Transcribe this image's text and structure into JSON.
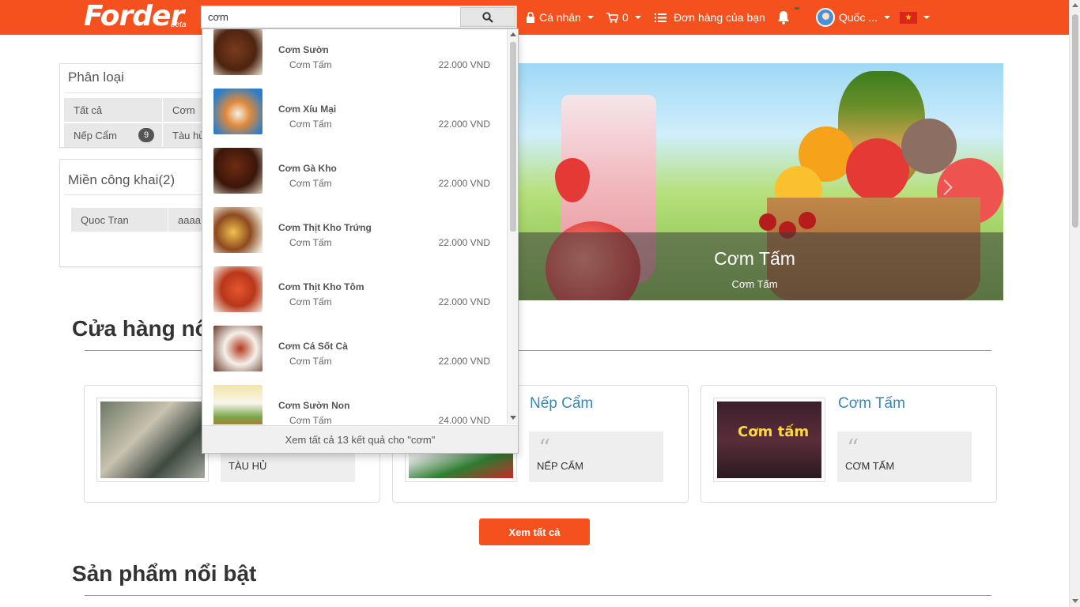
{
  "header": {
    "logo_text": "Forder",
    "logo_badge": "beta",
    "search": {
      "value": "cơm",
      "placeholder": ""
    },
    "nav": {
      "personal_label": "Cá nhân",
      "cart_count": "0",
      "orders_label": "Đơn hàng của bạn",
      "user_label": "Quốc ...",
      "flag_star": "★"
    }
  },
  "colors": {
    "brand": "#f4511e",
    "link": "#3a87b5"
  },
  "search_dropdown": {
    "items": [
      {
        "name": "Cơm Sườn",
        "category": "Cơm Tấm",
        "price": "22.000 VND"
      },
      {
        "name": "Cơm Xíu Mại",
        "category": "Cơm Tấm",
        "price": "22.000 VND"
      },
      {
        "name": "Cơm Gà Kho",
        "category": "Cơm Tấm",
        "price": "22.000 VND"
      },
      {
        "name": "Cơm Thịt Kho Trứng",
        "category": "Cơm Tấm",
        "price": "22.000 VND"
      },
      {
        "name": "Cơm Thịt Kho Tôm",
        "category": "Cơm Tấm",
        "price": "22.000 VND"
      },
      {
        "name": "Cơm Cá Sốt Cà",
        "category": "Cơm Tấm",
        "price": "22.000 VND"
      },
      {
        "name": "Cơm Sườn Non",
        "category": "Cơm Tấm",
        "price": "24.000 VND"
      }
    ],
    "footer": "Xem tất cả 13 kết quả cho \"cơm\""
  },
  "sidebar": {
    "category_panel": {
      "title": "Phân loại",
      "chips": [
        {
          "label": "Tất cả",
          "badge": ""
        },
        {
          "label": "Cơm",
          "badge": ""
        },
        {
          "label": "Nếp Cẩm",
          "badge": "9"
        },
        {
          "label": "Tàu hủ",
          "badge": ""
        }
      ]
    },
    "public_panel": {
      "title": "Miền công khai(2)",
      "chips": [
        {
          "label": "Quoc Tran"
        },
        {
          "label": "aaaa"
        }
      ]
    }
  },
  "banner": {
    "title": "Cơm Tấm",
    "subtitle": "Cơm Tấm"
  },
  "featured_stores": {
    "title": "Cửa hàng nổi bật",
    "cards": [
      {
        "title": "",
        "quote": "TÀU HỦ"
      },
      {
        "title": "Nếp Cẩm",
        "quote": "NẾP CẨM"
      },
      {
        "title": "Cơm Tấm",
        "quote": "CƠM TẤM",
        "sign_text": "Cơm tấm"
      }
    ],
    "view_all_label": "Xem tất cả"
  },
  "featured_products": {
    "title": "Sản phẩm nổi bật"
  }
}
